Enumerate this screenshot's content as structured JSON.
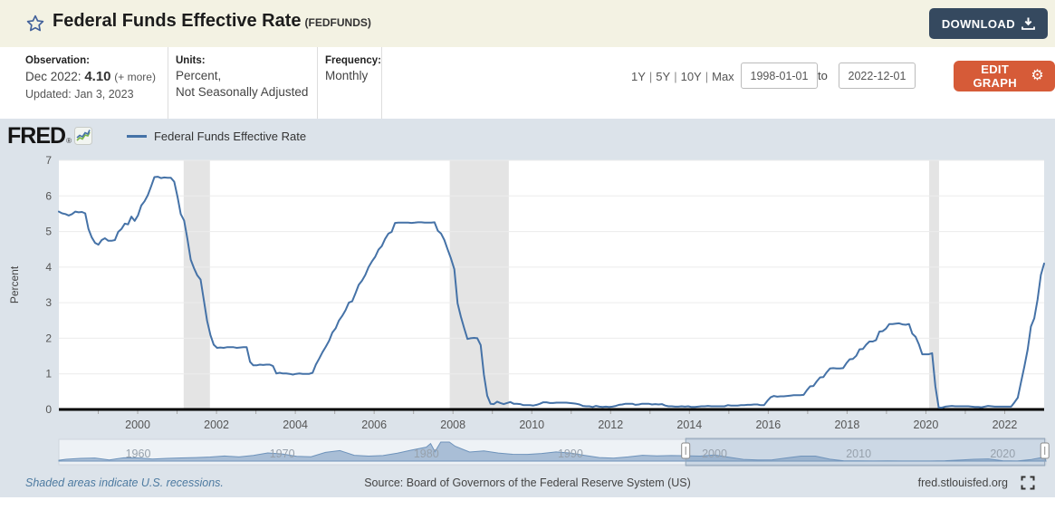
{
  "header": {
    "title": "Federal Funds Effective Rate",
    "series_id": "(FEDFUNDS)",
    "download_label": "DOWNLOAD"
  },
  "meta": {
    "observation": {
      "label": "Observation:",
      "date": "Dec 2022:",
      "value": "4.10",
      "more": "(+ more)",
      "updated": "Updated: Jan 3, 2023"
    },
    "units": {
      "label": "Units:",
      "line1": "Percent,",
      "line2": "Not Seasonally Adjusted"
    },
    "frequency": {
      "label": "Frequency:",
      "value": "Monthly"
    },
    "ranges": {
      "items": [
        "1Y",
        "5Y",
        "10Y",
        "Max"
      ],
      "separator": "|"
    },
    "date_from": "1998-01-01",
    "to_word": "to",
    "date_to": "2022-12-01",
    "edit_graph_label": "EDIT GRAPH"
  },
  "graph": {
    "logo_text": "FRED",
    "logo_reg": "®",
    "legend_label": "Federal Funds Effective Rate"
  },
  "footer": {
    "recession_note": "Shaded areas indicate U.S. recessions.",
    "source": "Source: Board of Governors of the Federal Reserve System (US)",
    "site": "fred.stlouisfed.org"
  },
  "icons": {
    "star": "star-outline",
    "download": "arrow-down-tray",
    "gear": "⚙",
    "fullscreen": "corner-brackets",
    "fred_logo_chart": "sparkline"
  },
  "colors": {
    "header_bg": "#f3f2e3",
    "download_btn": "#35495f",
    "edit_btn": "#d65b38",
    "panel_bg": "#dce3ea",
    "line": "#4572a7",
    "recession": "#e4e4e4",
    "grid": "#ececec",
    "slider_fill": "#a9bed6",
    "slider_line": "#6e93bb",
    "slider_selection": "rgba(120,150,185,0.28)"
  },
  "chart_data": [
    {
      "type": "line",
      "title": "Federal Funds Effective Rate",
      "ylabel": "Percent",
      "ylim": [
        0,
        7
      ],
      "yticks": [
        0,
        1,
        2,
        3,
        4,
        5,
        6,
        7
      ],
      "xlim": [
        1998.0,
        2023.0
      ],
      "xticks": [
        2000,
        2002,
        2004,
        2006,
        2008,
        2010,
        2012,
        2014,
        2016,
        2018,
        2020,
        2022
      ],
      "grid": true,
      "legend_position": "top-left",
      "x_start": "1998-01",
      "x_end": "2022-12",
      "recessions": [
        [
          2001.167,
          2001.833
        ],
        [
          2007.917,
          2009.417
        ],
        [
          2020.083,
          2020.333
        ]
      ],
      "values": [
        5.56,
        5.51,
        5.49,
        5.45,
        5.49,
        5.56,
        5.54,
        5.55,
        5.51,
        5.07,
        4.83,
        4.68,
        4.63,
        4.76,
        4.81,
        4.74,
        4.74,
        4.76,
        4.99,
        5.07,
        5.22,
        5.2,
        5.42,
        5.3,
        5.45,
        5.73,
        5.85,
        6.02,
        6.27,
        6.53,
        6.54,
        6.5,
        6.52,
        6.51,
        6.51,
        6.4,
        5.98,
        5.49,
        5.31,
        4.8,
        4.21,
        3.97,
        3.77,
        3.65,
        3.07,
        2.49,
        2.09,
        1.82,
        1.73,
        1.74,
        1.73,
        1.75,
        1.75,
        1.75,
        1.73,
        1.74,
        1.75,
        1.75,
        1.34,
        1.24,
        1.24,
        1.26,
        1.25,
        1.26,
        1.26,
        1.22,
        1.01,
        1.03,
        1.01,
        1.01,
        1.0,
        0.98,
        1.0,
        1.01,
        1.0,
        1.0,
        1.0,
        1.03,
        1.26,
        1.43,
        1.61,
        1.76,
        1.93,
        2.16,
        2.28,
        2.5,
        2.63,
        2.79,
        3.0,
        3.04,
        3.26,
        3.5,
        3.62,
        3.78,
        4.0,
        4.16,
        4.29,
        4.49,
        4.59,
        4.79,
        4.94,
        4.99,
        5.24,
        5.25,
        5.25,
        5.25,
        5.25,
        5.24,
        5.25,
        5.26,
        5.26,
        5.25,
        5.25,
        5.25,
        5.26,
        5.02,
        4.94,
        4.76,
        4.49,
        4.24,
        3.94,
        2.98,
        2.61,
        2.28,
        1.98,
        2.0,
        2.01,
        2.0,
        1.81,
        0.97,
        0.39,
        0.16,
        0.15,
        0.22,
        0.18,
        0.15,
        0.18,
        0.21,
        0.16,
        0.16,
        0.15,
        0.12,
        0.12,
        0.12,
        0.11,
        0.13,
        0.16,
        0.2,
        0.2,
        0.18,
        0.18,
        0.19,
        0.19,
        0.19,
        0.19,
        0.18,
        0.17,
        0.16,
        0.14,
        0.1,
        0.09,
        0.09,
        0.07,
        0.1,
        0.08,
        0.07,
        0.08,
        0.07,
        0.08,
        0.1,
        0.13,
        0.14,
        0.16,
        0.16,
        0.16,
        0.13,
        0.14,
        0.16,
        0.16,
        0.16,
        0.14,
        0.15,
        0.14,
        0.15,
        0.11,
        0.09,
        0.09,
        0.08,
        0.08,
        0.09,
        0.08,
        0.09,
        0.07,
        0.07,
        0.08,
        0.09,
        0.09,
        0.1,
        0.09,
        0.09,
        0.09,
        0.09,
        0.09,
        0.12,
        0.11,
        0.11,
        0.11,
        0.12,
        0.12,
        0.13,
        0.13,
        0.14,
        0.14,
        0.12,
        0.12,
        0.24,
        0.34,
        0.38,
        0.36,
        0.37,
        0.37,
        0.38,
        0.39,
        0.4,
        0.4,
        0.4,
        0.41,
        0.54,
        0.65,
        0.66,
        0.79,
        0.9,
        0.91,
        1.04,
        1.15,
        1.16,
        1.15,
        1.15,
        1.16,
        1.3,
        1.41,
        1.42,
        1.51,
        1.69,
        1.7,
        1.82,
        1.91,
        1.91,
        1.95,
        2.19,
        2.2,
        2.27,
        2.4,
        2.4,
        2.41,
        2.42,
        2.39,
        2.38,
        2.4,
        2.13,
        2.04,
        1.83,
        1.55,
        1.55,
        1.55,
        1.58,
        0.65,
        0.05,
        0.05,
        0.08,
        0.09,
        0.1,
        0.09,
        0.09,
        0.09,
        0.09,
        0.09,
        0.08,
        0.07,
        0.07,
        0.06,
        0.08,
        0.1,
        0.09,
        0.08,
        0.08,
        0.08,
        0.08,
        0.08,
        0.08,
        0.2,
        0.33,
        0.77,
        1.21,
        1.68,
        2.33,
        2.56,
        3.08,
        3.78,
        4.1
      ]
    },
    {
      "type": "area",
      "title": "range-slider-overview",
      "xlim": [
        1954.5,
        2023.0
      ],
      "ylim": [
        0,
        20
      ],
      "xticks": [
        1960,
        1970,
        1980,
        1990,
        2000,
        2010,
        2020
      ],
      "selection": [
        1998.0,
        2022.92
      ],
      "x": [
        1954.5,
        1955,
        1956,
        1957,
        1958,
        1959,
        1960,
        1961,
        1962,
        1963,
        1964,
        1965,
        1966,
        1967,
        1968,
        1969,
        1970,
        1971,
        1972,
        1973,
        1974,
        1975,
        1976,
        1977,
        1978,
        1979,
        1980,
        1980.3,
        1980.6,
        1981,
        1981.6,
        1982,
        1983,
        1984,
        1985,
        1986,
        1987,
        1988,
        1989,
        1990,
        1991,
        1992,
        1993,
        1994,
        1995,
        1996,
        1997,
        1998,
        1999,
        2000,
        2001,
        2002,
        2003,
        2004,
        2005,
        2006,
        2007,
        2008,
        2009,
        2010,
        2011,
        2012,
        2013,
        2014,
        2015,
        2016,
        2017,
        2018,
        2019,
        2020,
        2021,
        2022,
        2022.92
      ],
      "values": [
        0.8,
        1.8,
        2.7,
        3.1,
        1.2,
        3.3,
        3.2,
        2.0,
        2.7,
        3.2,
        3.5,
        4.1,
        5.1,
        4.2,
        5.7,
        8.2,
        7.2,
        4.7,
        4.4,
        8.7,
        10.5,
        5.8,
        5.0,
        5.5,
        7.9,
        11.2,
        14.0,
        17.6,
        9.5,
        19.1,
        19.1,
        14.9,
        9.1,
        10.2,
        8.1,
        6.8,
        6.7,
        7.6,
        9.2,
        8.1,
        5.7,
        3.5,
        3.0,
        4.2,
        5.8,
        5.3,
        5.5,
        5.4,
        5.0,
        6.2,
        3.9,
        1.7,
        1.1,
        1.3,
        3.2,
        5.0,
        5.0,
        1.9,
        0.16,
        0.17,
        0.1,
        0.14,
        0.11,
        0.09,
        0.13,
        0.39,
        1.0,
        1.8,
        2.2,
        0.36,
        0.08,
        1.68,
        4.1
      ]
    }
  ]
}
